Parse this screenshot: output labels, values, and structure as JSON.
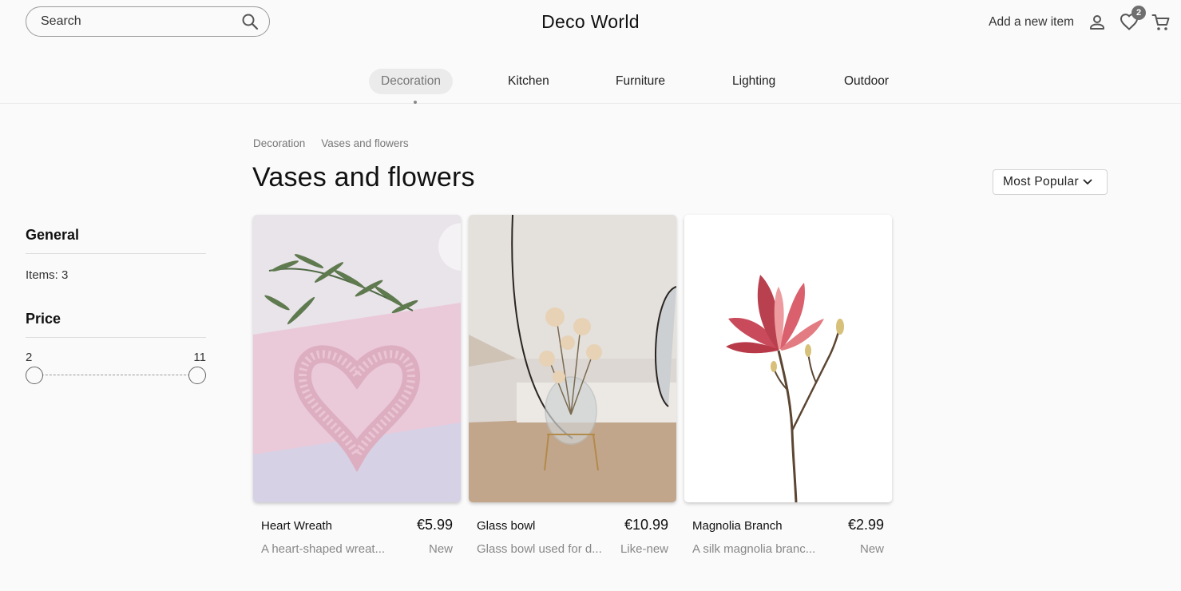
{
  "header": {
    "search_placeholder": "Search",
    "brand": "Deco World",
    "add_item_label": "Add a new item",
    "wishlist_count": "2"
  },
  "categories": [
    {
      "label": "Decoration",
      "active": true
    },
    {
      "label": "Kitchen",
      "active": false
    },
    {
      "label": "Furniture",
      "active": false
    },
    {
      "label": "Lighting",
      "active": false
    },
    {
      "label": "Outdoor",
      "active": false
    }
  ],
  "breadcrumb": [
    "Decoration",
    "Vases and flowers"
  ],
  "page": {
    "title": "Vases and flowers",
    "sort_label": "Most Popular"
  },
  "sidebar": {
    "general_title": "General",
    "items_text": "Items: 3",
    "price_title": "Price",
    "price_min": "2",
    "price_max": "11"
  },
  "products": [
    {
      "name": "Heart Wreath",
      "price": "€5.99",
      "description": "A heart-shaped wreat...",
      "condition": "New"
    },
    {
      "name": "Glass bowl",
      "price": "€10.99",
      "description": "Glass bowl used for d...",
      "condition": "Like-new"
    },
    {
      "name": "Magnolia Branch",
      "price": "€2.99",
      "description": "A silk magnolia branc...",
      "condition": "New"
    }
  ],
  "icons": {
    "search": "search-icon",
    "account": "user-icon",
    "wishlist": "heart-icon",
    "cart": "cart-icon",
    "sort": "chevron-down-icon"
  },
  "colors": {
    "background": "#fafafa",
    "active_tab_bg": "#ebebeb",
    "muted_text": "#888888",
    "badge": "#6e6e6e"
  }
}
